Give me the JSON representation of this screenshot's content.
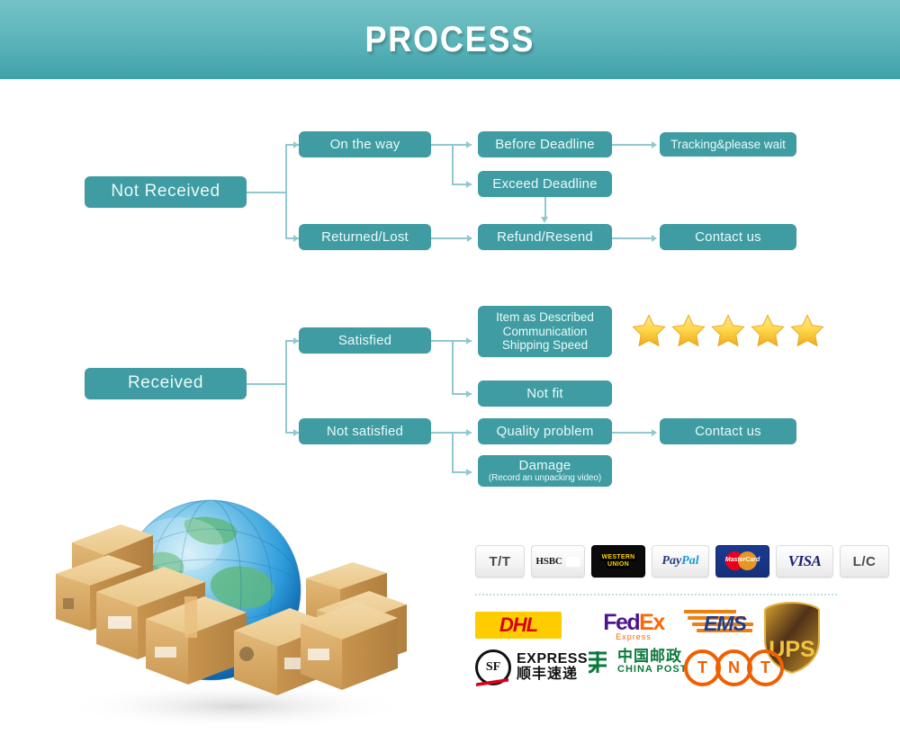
{
  "header": {
    "title": "PROCESS"
  },
  "flow_not_received": {
    "root": "Not Received",
    "branch_on_the_way": "On the way",
    "branch_returned_lost": "Returned/Lost",
    "before_deadline": "Before Deadline",
    "exceed_deadline": "Exceed Deadline",
    "refund_resend": "Refund/Resend",
    "tracking_please_wait": "Tracking&please wait",
    "contact_us": "Contact us"
  },
  "flow_received": {
    "root": "Received",
    "branch_satisfied": "Satisfied",
    "branch_not_satisfied": "Not satisfied",
    "rating_box_line1": "Item as Described",
    "rating_box_line2": "Communication",
    "rating_box_line3": "Shipping Speed",
    "not_fit": "Not fit",
    "quality_problem": "Quality problem",
    "damage_title": "Damage",
    "damage_sub": "(Record an unpacking video)",
    "contact_us": "Contact us",
    "star_count": 5
  },
  "payment_methods": [
    {
      "name": "T/T",
      "label": "T/T"
    },
    {
      "name": "HSBC",
      "label": "HSBC"
    },
    {
      "name": "Western Union",
      "label_line1": "WESTERN",
      "label_line2": "UNION"
    },
    {
      "name": "PayPal",
      "label_a": "Pay",
      "label_b": "Pal"
    },
    {
      "name": "MasterCard",
      "label": "MasterCard"
    },
    {
      "name": "VISA",
      "label": "VISA"
    },
    {
      "name": "L/C",
      "label": "L/C"
    }
  ],
  "shipping_carriers": [
    {
      "name": "DHL",
      "label": "DHL"
    },
    {
      "name": "FedEx",
      "label_a": "Fed",
      "label_b": "Ex",
      "sub": "Express"
    },
    {
      "name": "EMS",
      "label": "EMS"
    },
    {
      "name": "UPS",
      "label": "UPS"
    },
    {
      "name": "SF Express",
      "mark": "SF",
      "label_en": "EXPRESS",
      "label_cn": "顺丰速递"
    },
    {
      "name": "China Post",
      "label_cn": "中国邮政",
      "label_en": "CHINA  POST"
    },
    {
      "name": "TNT",
      "l1": "T",
      "l2": "N",
      "l3": "T"
    }
  ],
  "graphic": {
    "alt": "globe surrounded by shipping cartons"
  },
  "colors": {
    "header_top": "#74c2c6",
    "header_bottom": "#3fa2aa",
    "box_teal": "#3f9ca2",
    "connector": "#8fc9cd",
    "star_gold": "#f5c518",
    "divider": "#bfe0e2"
  }
}
